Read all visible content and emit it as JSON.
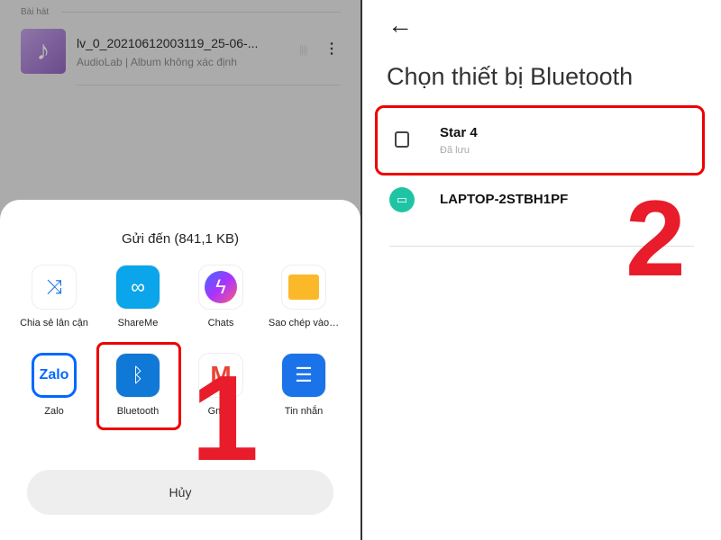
{
  "background": {
    "section": "Bài hát",
    "song": {
      "title": "lv_0_20210612003119_25-06-...",
      "subtitle": "AudioLab | Album không xác định"
    }
  },
  "share_sheet": {
    "title": "Gửi đến (841,1 KB)",
    "apps": [
      {
        "label": "Chia sẻ lân cận",
        "icon": "nearby-share-icon"
      },
      {
        "label": "ShareMe",
        "icon": "shareme-icon"
      },
      {
        "label": "Chats",
        "icon": "messenger-icon"
      },
      {
        "label": "Sao chép vào…",
        "icon": "folder-icon"
      },
      {
        "label": "Zalo",
        "icon": "zalo-icon"
      },
      {
        "label": "Bluetooth",
        "icon": "bluetooth-icon"
      },
      {
        "label": "Gmail",
        "icon": "gmail-icon"
      },
      {
        "label": "Tin nhắn",
        "icon": "messages-icon"
      }
    ],
    "cancel": "Hủy"
  },
  "step_labels": [
    "1",
    "2"
  ],
  "bluetooth": {
    "title": "Chọn thiết bị Bluetooth",
    "devices": [
      {
        "name": "Star 4",
        "status": "Đã lưu",
        "icon": "device-icon"
      },
      {
        "name": "LAPTOP-2STBH1PF",
        "icon": "laptop-icon"
      }
    ]
  },
  "colors": {
    "highlight": "#e00000",
    "annotation": "#e81c2a",
    "laptop_icon": "#1fc4a4"
  }
}
